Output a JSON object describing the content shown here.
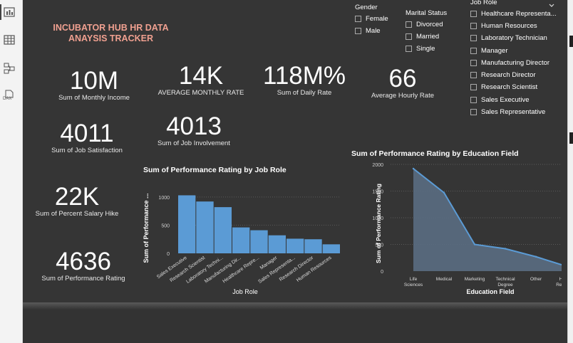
{
  "sidebar": {
    "icons": [
      "report-view-icon",
      "table-view-icon",
      "model-view-icon",
      "dax-query-view-icon"
    ],
    "dax_label": "DAX"
  },
  "report": {
    "title_line1": "INCUBATOR HUB HR DATA",
    "title_line2": "ANAYSIS TRACKER"
  },
  "kpis": {
    "monthly_income": {
      "value": "10M",
      "label": "Sum of Monthly Income"
    },
    "monthly_rate": {
      "value": "14K",
      "label": "AVERAGE MONTHLY RATE"
    },
    "daily_rate": {
      "value": "118M%",
      "label": "Sum of Daily Rate"
    },
    "hourly_rate": {
      "value": "66",
      "label": "Average Hourly Rate"
    },
    "job_satisfaction": {
      "value": "4011",
      "label": "Sum of Job Satisfaction"
    },
    "job_involvement": {
      "value": "4013",
      "label": "Sum of Job Involvement"
    },
    "salary_hike": {
      "value": "22K",
      "label": "Sum of Percent Salary Hike"
    },
    "performance_rating": {
      "value": "4636",
      "label": "Sum of Performance Rating"
    }
  },
  "slicers": {
    "gender": {
      "title": "Gender",
      "options": [
        "Female",
        "Male"
      ]
    },
    "marital": {
      "title": "Marital Status",
      "options": [
        "Divorced",
        "Married",
        "Single"
      ]
    },
    "job_role": {
      "title": "Job Role",
      "options": [
        "Healthcare Representa...",
        "Human Resources",
        "Laboratory Technician",
        "Manager",
        "Manufacturing Director",
        "Research Director",
        "Research Scientist",
        "Sales Executive",
        "Sales Representative"
      ]
    }
  },
  "colors": {
    "canvas": "#353535",
    "accent_title": "#f0a090",
    "series": "#5b9bd5",
    "area_fill": "#5a6d82"
  },
  "chart_data": [
    {
      "type": "bar",
      "title": "Sum of Performance Rating by Job Role",
      "xlabel": "Job Role",
      "ylabel": "Sum of Performance ...",
      "categories": [
        "Sales Executive",
        "Research Scientist",
        "Laboratory Techni...",
        "Manufacturing Dir...",
        "Healthcare Repre...",
        "Manager",
        "Sales Representa...",
        "Research Director",
        "Human Resources"
      ],
      "values": [
        1030,
        920,
        820,
        460,
        410,
        320,
        260,
        250,
        160
      ],
      "ylim": [
        0,
        1200
      ],
      "yticks": [
        "0",
        "500",
        "1000"
      ],
      "grid": true
    },
    {
      "type": "area",
      "title": "Sum of Performance Rating by Education Field",
      "xlabel": "Education Field",
      "ylabel": "Sum of Performance Rating",
      "categories": [
        "Life Sciences",
        "Medical",
        "Marketing",
        "Technical Degree",
        "Other",
        "Human Resourc..."
      ],
      "category_lines": [
        [
          "Life",
          "Sciences"
        ],
        [
          "Medical"
        ],
        [
          "Marketing"
        ],
        [
          "Technical",
          "Degree"
        ],
        [
          "Other"
        ],
        [
          "Human",
          "Resourc..."
        ]
      ],
      "values": [
        1920,
        1470,
        500,
        420,
        270,
        90
      ],
      "ylim": [
        0,
        2000
      ],
      "yticks": [
        "0",
        "500",
        "1000",
        "1500",
        "2000"
      ],
      "grid": true
    }
  ]
}
